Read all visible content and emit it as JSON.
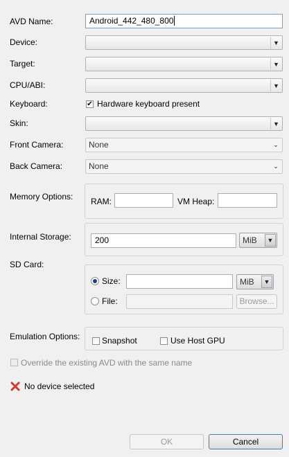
{
  "labels": {
    "avd_name": "AVD Name:",
    "device": "Device:",
    "target": "Target:",
    "cpu_abi": "CPU/ABI:",
    "keyboard": "Keyboard:",
    "skin": "Skin:",
    "front_camera": "Front Camera:",
    "back_camera": "Back Camera:",
    "memory_options": "Memory Options:",
    "internal_storage": "Internal Storage:",
    "sd_card": "SD Card:",
    "emulation_options": "Emulation Options:"
  },
  "avd_name": {
    "value": "Android_442_480_800"
  },
  "device": {
    "value": ""
  },
  "target": {
    "value": ""
  },
  "cpu_abi": {
    "value": ""
  },
  "keyboard": {
    "label": "Hardware keyboard present",
    "checked": true
  },
  "skin": {
    "value": ""
  },
  "front_camera": {
    "value": "None"
  },
  "back_camera": {
    "value": "None"
  },
  "memory": {
    "ram_label": "RAM:",
    "ram_value": "",
    "vm_heap_label": "VM Heap:",
    "vm_heap_value": ""
  },
  "internal_storage": {
    "value": "200",
    "unit": "MiB"
  },
  "sd_card": {
    "size_label": "Size:",
    "size_value": "",
    "size_unit": "MiB",
    "file_label": "File:",
    "file_value": "",
    "browse_label": "Browse...",
    "selected": "size"
  },
  "emulation": {
    "snapshot_label": "Snapshot",
    "host_gpu_label": "Use Host GPU"
  },
  "override": {
    "label": "Override the existing AVD with the same name"
  },
  "status": {
    "message": "No device selected",
    "icon": "error-x-icon",
    "color": "#d9352a"
  },
  "buttons": {
    "ok": "OK",
    "cancel": "Cancel"
  }
}
